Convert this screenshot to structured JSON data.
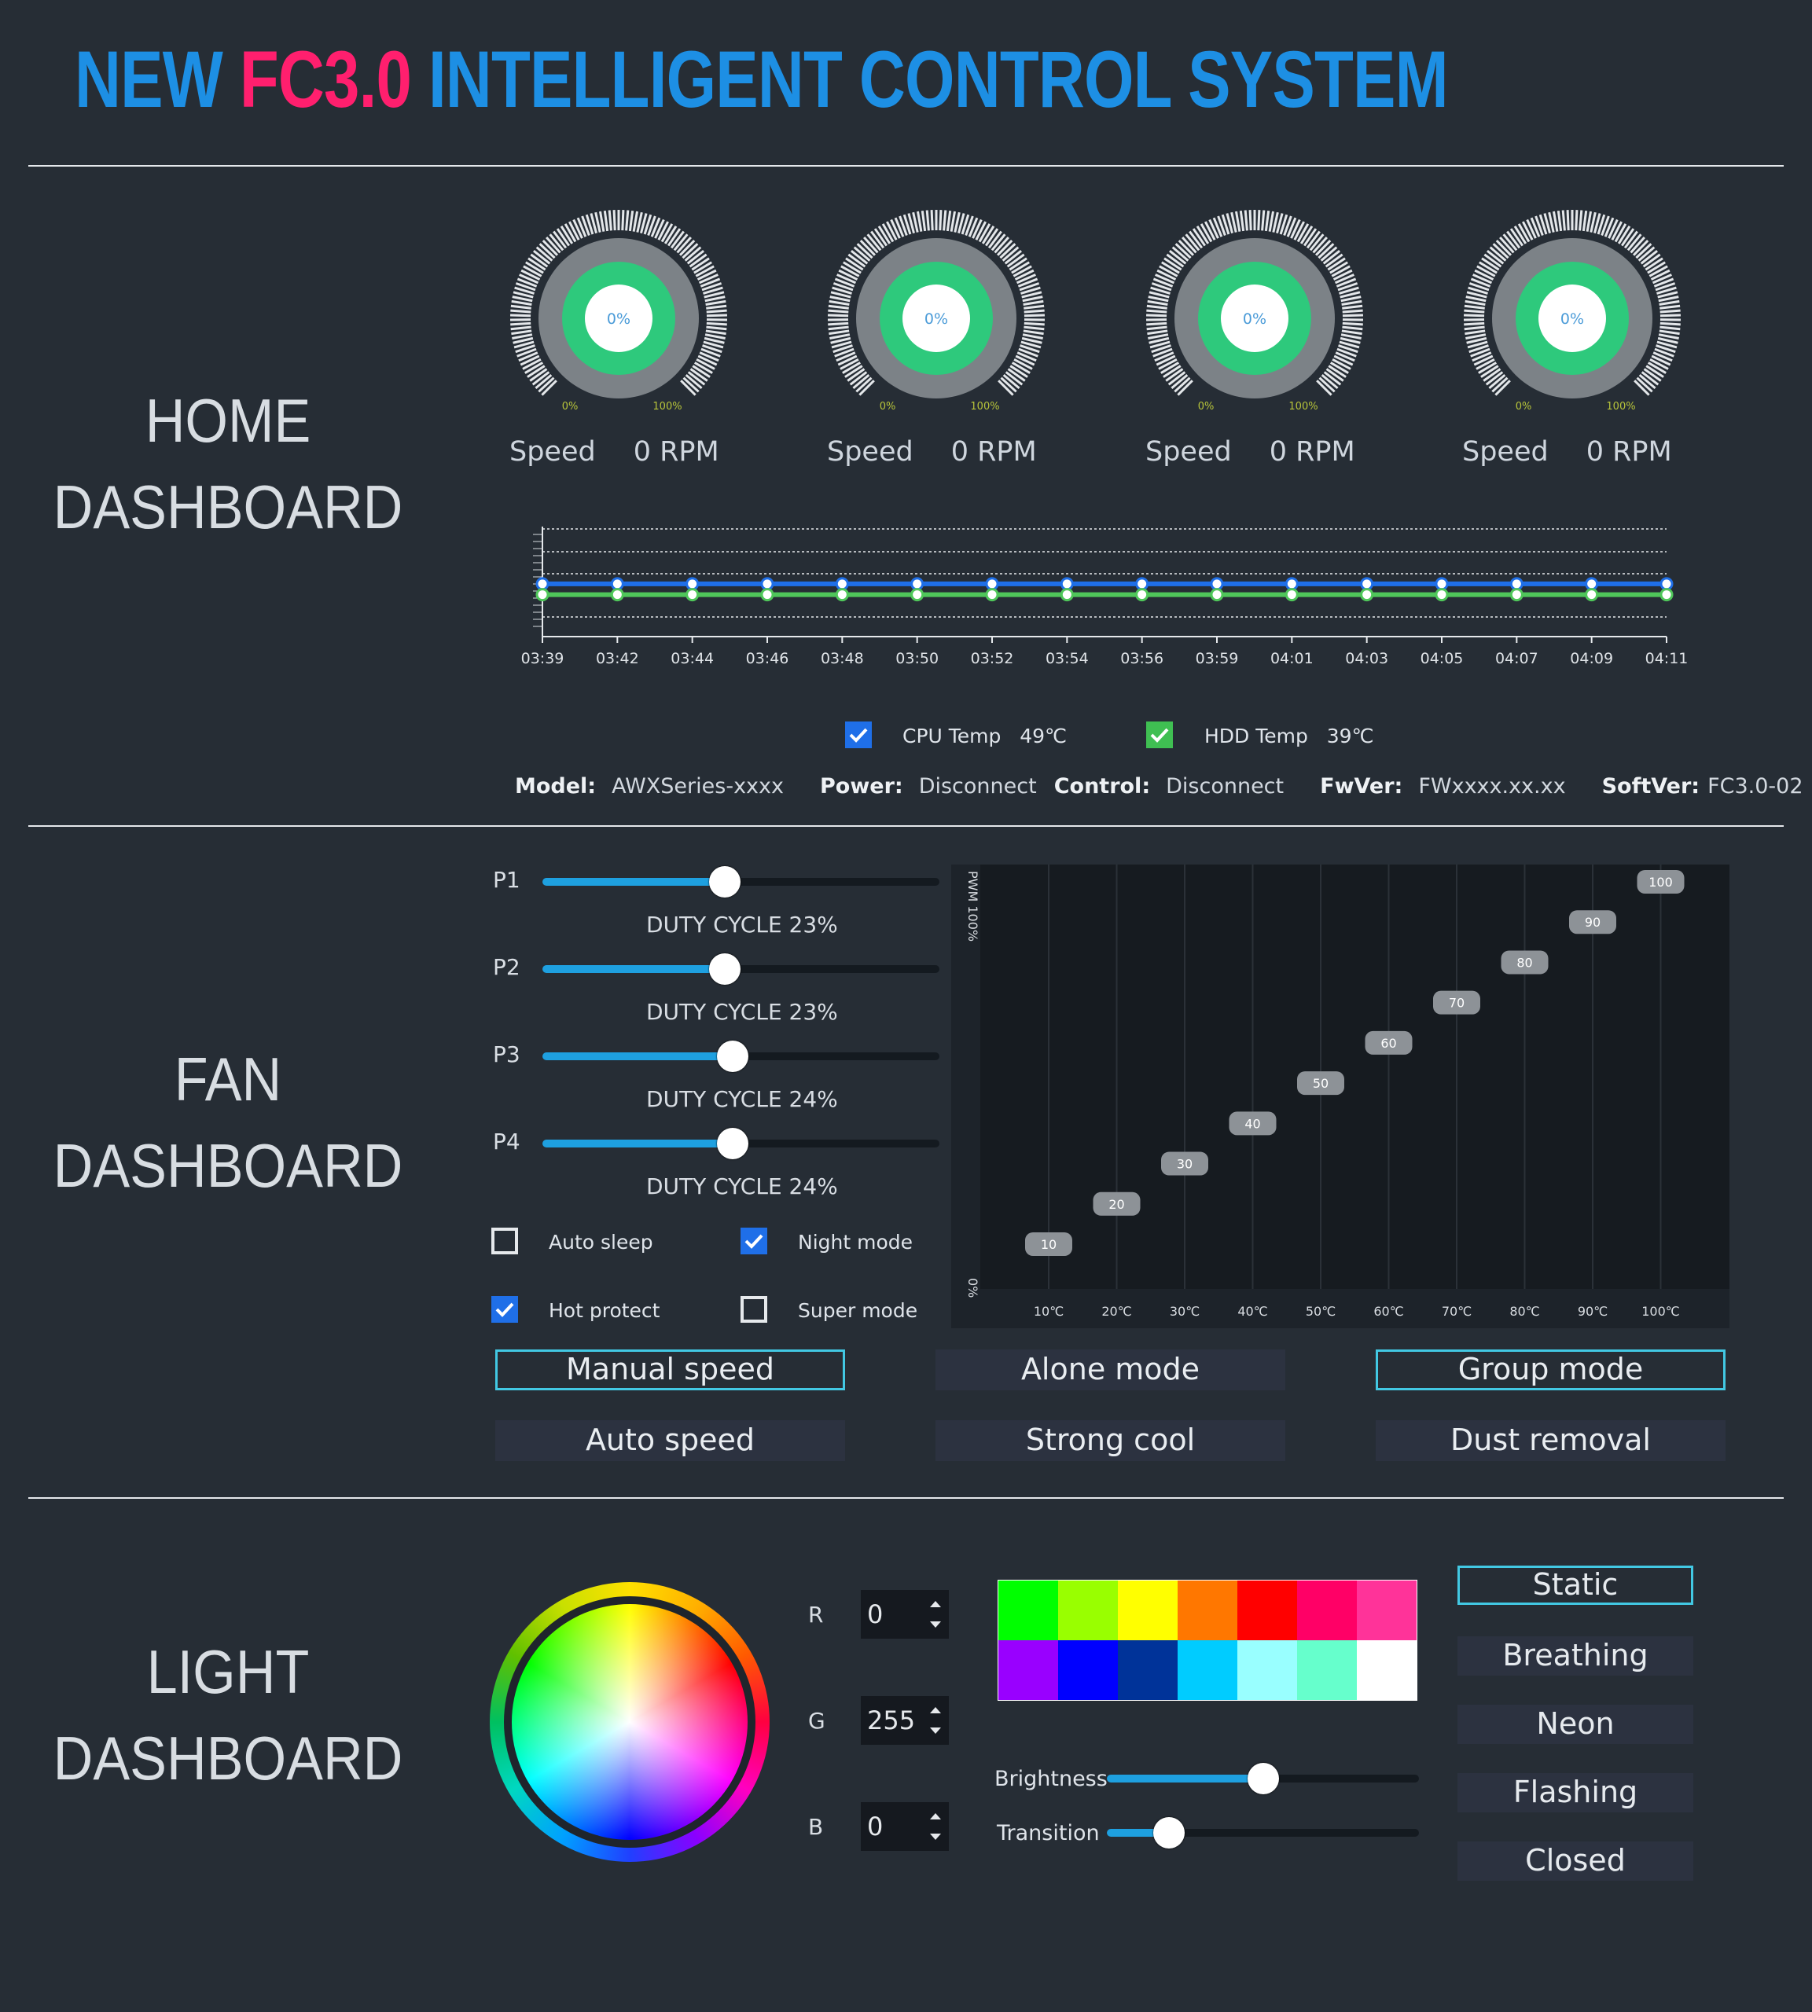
{
  "title": {
    "part1": "NEW",
    "part2": "FC3.0",
    "part3": "INTELLIGENT CONTROL SYSTEM"
  },
  "sections": {
    "home": [
      "HOME",
      "DASHBOARD"
    ],
    "fan": [
      "FAN",
      "DASHBOARD"
    ],
    "light": [
      "LIGHT",
      "DASHBOARD"
    ]
  },
  "gauges": [
    {
      "center": "0%",
      "min": "0%",
      "max": "100%",
      "speed_label": "Speed",
      "speed_value": "0 RPM",
      "value": 0
    },
    {
      "center": "0%",
      "min": "0%",
      "max": "100%",
      "speed_label": "Speed",
      "speed_value": "0 RPM",
      "value": 0
    },
    {
      "center": "0%",
      "min": "0%",
      "max": "100%",
      "speed_label": "Speed",
      "speed_value": "0 RPM",
      "value": 0
    },
    {
      "center": "0%",
      "min": "0%",
      "max": "100%",
      "speed_label": "Speed",
      "speed_value": "0 RPM",
      "value": 0
    }
  ],
  "chart_data": [
    {
      "type": "line",
      "x": [
        "03:39",
        "03:42",
        "03:44",
        "03:46",
        "03:48",
        "03:50",
        "03:52",
        "03:54",
        "03:56",
        "03:59",
        "04:01",
        "04:03",
        "04:05",
        "04:07",
        "04:09",
        "04:11"
      ],
      "series": [
        {
          "name": "CPU Temp",
          "color": "#1f6fe8",
          "values": [
            49,
            49,
            49,
            49,
            49,
            49,
            49,
            49,
            49,
            49,
            49,
            49,
            49,
            49,
            49,
            49
          ]
        },
        {
          "name": "HDD Temp",
          "color": "#4fc65a",
          "values": [
            39,
            39,
            39,
            39,
            39,
            39,
            39,
            39,
            39,
            39,
            39,
            39,
            39,
            39,
            39,
            39
          ]
        }
      ],
      "ylim": [
        0,
        100
      ],
      "grid": true
    },
    {
      "type": "line",
      "x": [
        "10℃",
        "20℃",
        "30℃",
        "40℃",
        "50℃",
        "60℃",
        "70℃",
        "80℃",
        "90℃",
        "100℃"
      ],
      "values": [
        10,
        20,
        30,
        40,
        50,
        60,
        70,
        80,
        90,
        100
      ],
      "ylabel_top": "PWM 100%",
      "ylabel_bottom": "0%",
      "ylim": [
        0,
        100
      ],
      "grid": true
    }
  ],
  "legend": {
    "cpu": {
      "label": "CPU Temp",
      "value": "49℃",
      "checked": true,
      "color": "#1f6fe8"
    },
    "hdd": {
      "label": "HDD Temp",
      "value": "39℃",
      "checked": true,
      "color": "#3fbf52"
    }
  },
  "info": {
    "model_label": "Model:",
    "model": "AWXSeries-xxxx",
    "power_label": "Power:",
    "power": "Disconnect",
    "control_label": "Control:",
    "control": "Disconnect",
    "fwver_label": "FwVer:",
    "fwver": "FWxxxx.xx.xx",
    "softver_label": "SoftVer:",
    "softver": "FC3.0-02"
  },
  "fans": [
    {
      "label": "P1",
      "duty_text": "DUTY CYCLE 23%",
      "value": 0.46
    },
    {
      "label": "P2",
      "duty_text": "DUTY CYCLE 23%",
      "value": 0.46
    },
    {
      "label": "P3",
      "duty_text": "DUTY CYCLE 24%",
      "value": 0.48
    },
    {
      "label": "P4",
      "duty_text": "DUTY CYCLE 24%",
      "value": 0.48
    }
  ],
  "options": {
    "auto_sleep": {
      "label": "Auto sleep",
      "checked": false
    },
    "night_mode": {
      "label": "Night mode",
      "checked": true
    },
    "hot_protect": {
      "label": "Hot protect",
      "checked": true
    },
    "super_mode": {
      "label": "Super mode",
      "checked": false
    }
  },
  "modes": [
    {
      "label": "Manual speed",
      "active": true
    },
    {
      "label": "Alone mode",
      "active": false
    },
    {
      "label": "Group mode",
      "active": true
    },
    {
      "label": "Auto speed",
      "active": false
    },
    {
      "label": "Strong cool",
      "active": false
    },
    {
      "label": "Dust removal",
      "active": false
    }
  ],
  "rgb": {
    "r": {
      "label": "R",
      "value": "0"
    },
    "g": {
      "label": "G",
      "value": "255"
    },
    "b": {
      "label": "B",
      "value": "0"
    }
  },
  "swatches": [
    "#00ff00",
    "#99ff00",
    "#ffff00",
    "#ff7700",
    "#ff0000",
    "#ff0066",
    "#ff3399",
    "#9900ff",
    "#0000ff",
    "#003399",
    "#00ccff",
    "#99ffff",
    "#66ffcc",
    "#ffffff"
  ],
  "brightness": {
    "label": "Brightness",
    "value": 0.5
  },
  "transition": {
    "label": "Transition",
    "value": 0.2
  },
  "light_modes": [
    {
      "label": "Static",
      "active": true
    },
    {
      "label": "Breathing",
      "active": false
    },
    {
      "label": "Neon",
      "active": false
    },
    {
      "label": "Flashing",
      "active": false
    },
    {
      "label": "Closed",
      "active": false
    }
  ]
}
